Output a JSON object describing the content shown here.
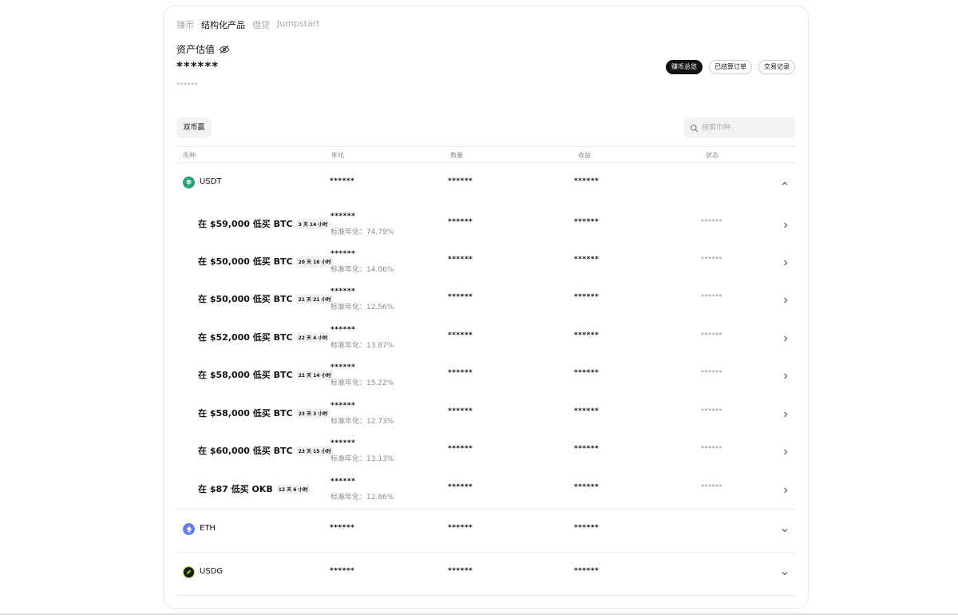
{
  "tabs": [
    "赚币",
    "结构化产品",
    "借贷",
    "Jumpstart"
  ],
  "asset": {
    "label": "资产估值",
    "value": "******",
    "sub_value": "******"
  },
  "actions": {
    "overview": "赚币总览",
    "settled_orders": "已结算订单",
    "trade_history": "交易记录"
  },
  "filter": {
    "label": "双币赢"
  },
  "search": {
    "placeholder": "搜索币种"
  },
  "table": {
    "headers": [
      "币种",
      "年化",
      "数量",
      "收益",
      "状态"
    ]
  },
  "coins": {
    "usdt": {
      "name": "USDT",
      "apy": "******",
      "amount": "******",
      "earnings": "******",
      "color": "#26a17b"
    },
    "eth": {
      "name": "ETH",
      "apy": "******",
      "amount": "******",
      "earnings": "******",
      "color": "#627eea"
    },
    "usdg": {
      "name": "USDG",
      "apy": "******",
      "amount": "******",
      "earnings": "******",
      "color": "#1a1a1a"
    }
  },
  "products": [
    {
      "title": "在 $59,000 低买 BTC",
      "duration": "3 天 14 小时",
      "apy_masked": "******",
      "apy_label": "标准年化：74.79%",
      "amount": "******",
      "earnings": "******",
      "status": "******"
    },
    {
      "title": "在 $50,000 低买 BTC",
      "duration": "20 天 16 小时",
      "apy_masked": "******",
      "apy_label": "标准年化：14.06%",
      "amount": "******",
      "earnings": "******",
      "status": "******"
    },
    {
      "title": "在 $50,000 低买 BTC",
      "duration": "21 天 21 小时",
      "apy_masked": "******",
      "apy_label": "标准年化：12.56%",
      "amount": "******",
      "earnings": "******",
      "status": "******"
    },
    {
      "title": "在 $52,000 低买 BTC",
      "duration": "22 天 4 小时",
      "apy_masked": "******",
      "apy_label": "标准年化：13.87%",
      "amount": "******",
      "earnings": "******",
      "status": "******"
    },
    {
      "title": "在 $58,000 低买 BTC",
      "duration": "22 天 14 小时",
      "apy_masked": "******",
      "apy_label": "标准年化：15.22%",
      "amount": "******",
      "earnings": "******",
      "status": "******"
    },
    {
      "title": "在 $58,000 低买 BTC",
      "duration": "23 天 3 小时",
      "apy_masked": "******",
      "apy_label": "标准年化：12.73%",
      "amount": "******",
      "earnings": "******",
      "status": "******"
    },
    {
      "title": "在 $60,000 低买 BTC",
      "duration": "23 天 15 小时",
      "apy_masked": "******",
      "apy_label": "标准年化：13.13%",
      "amount": "******",
      "earnings": "******",
      "status": "******"
    },
    {
      "title": "在 $87 低买 OKB",
      "duration": "12 天 6 小时",
      "apy_masked": "******",
      "apy_label": "标准年化：12.86%",
      "amount": "******",
      "earnings": "******",
      "status": "******"
    }
  ]
}
